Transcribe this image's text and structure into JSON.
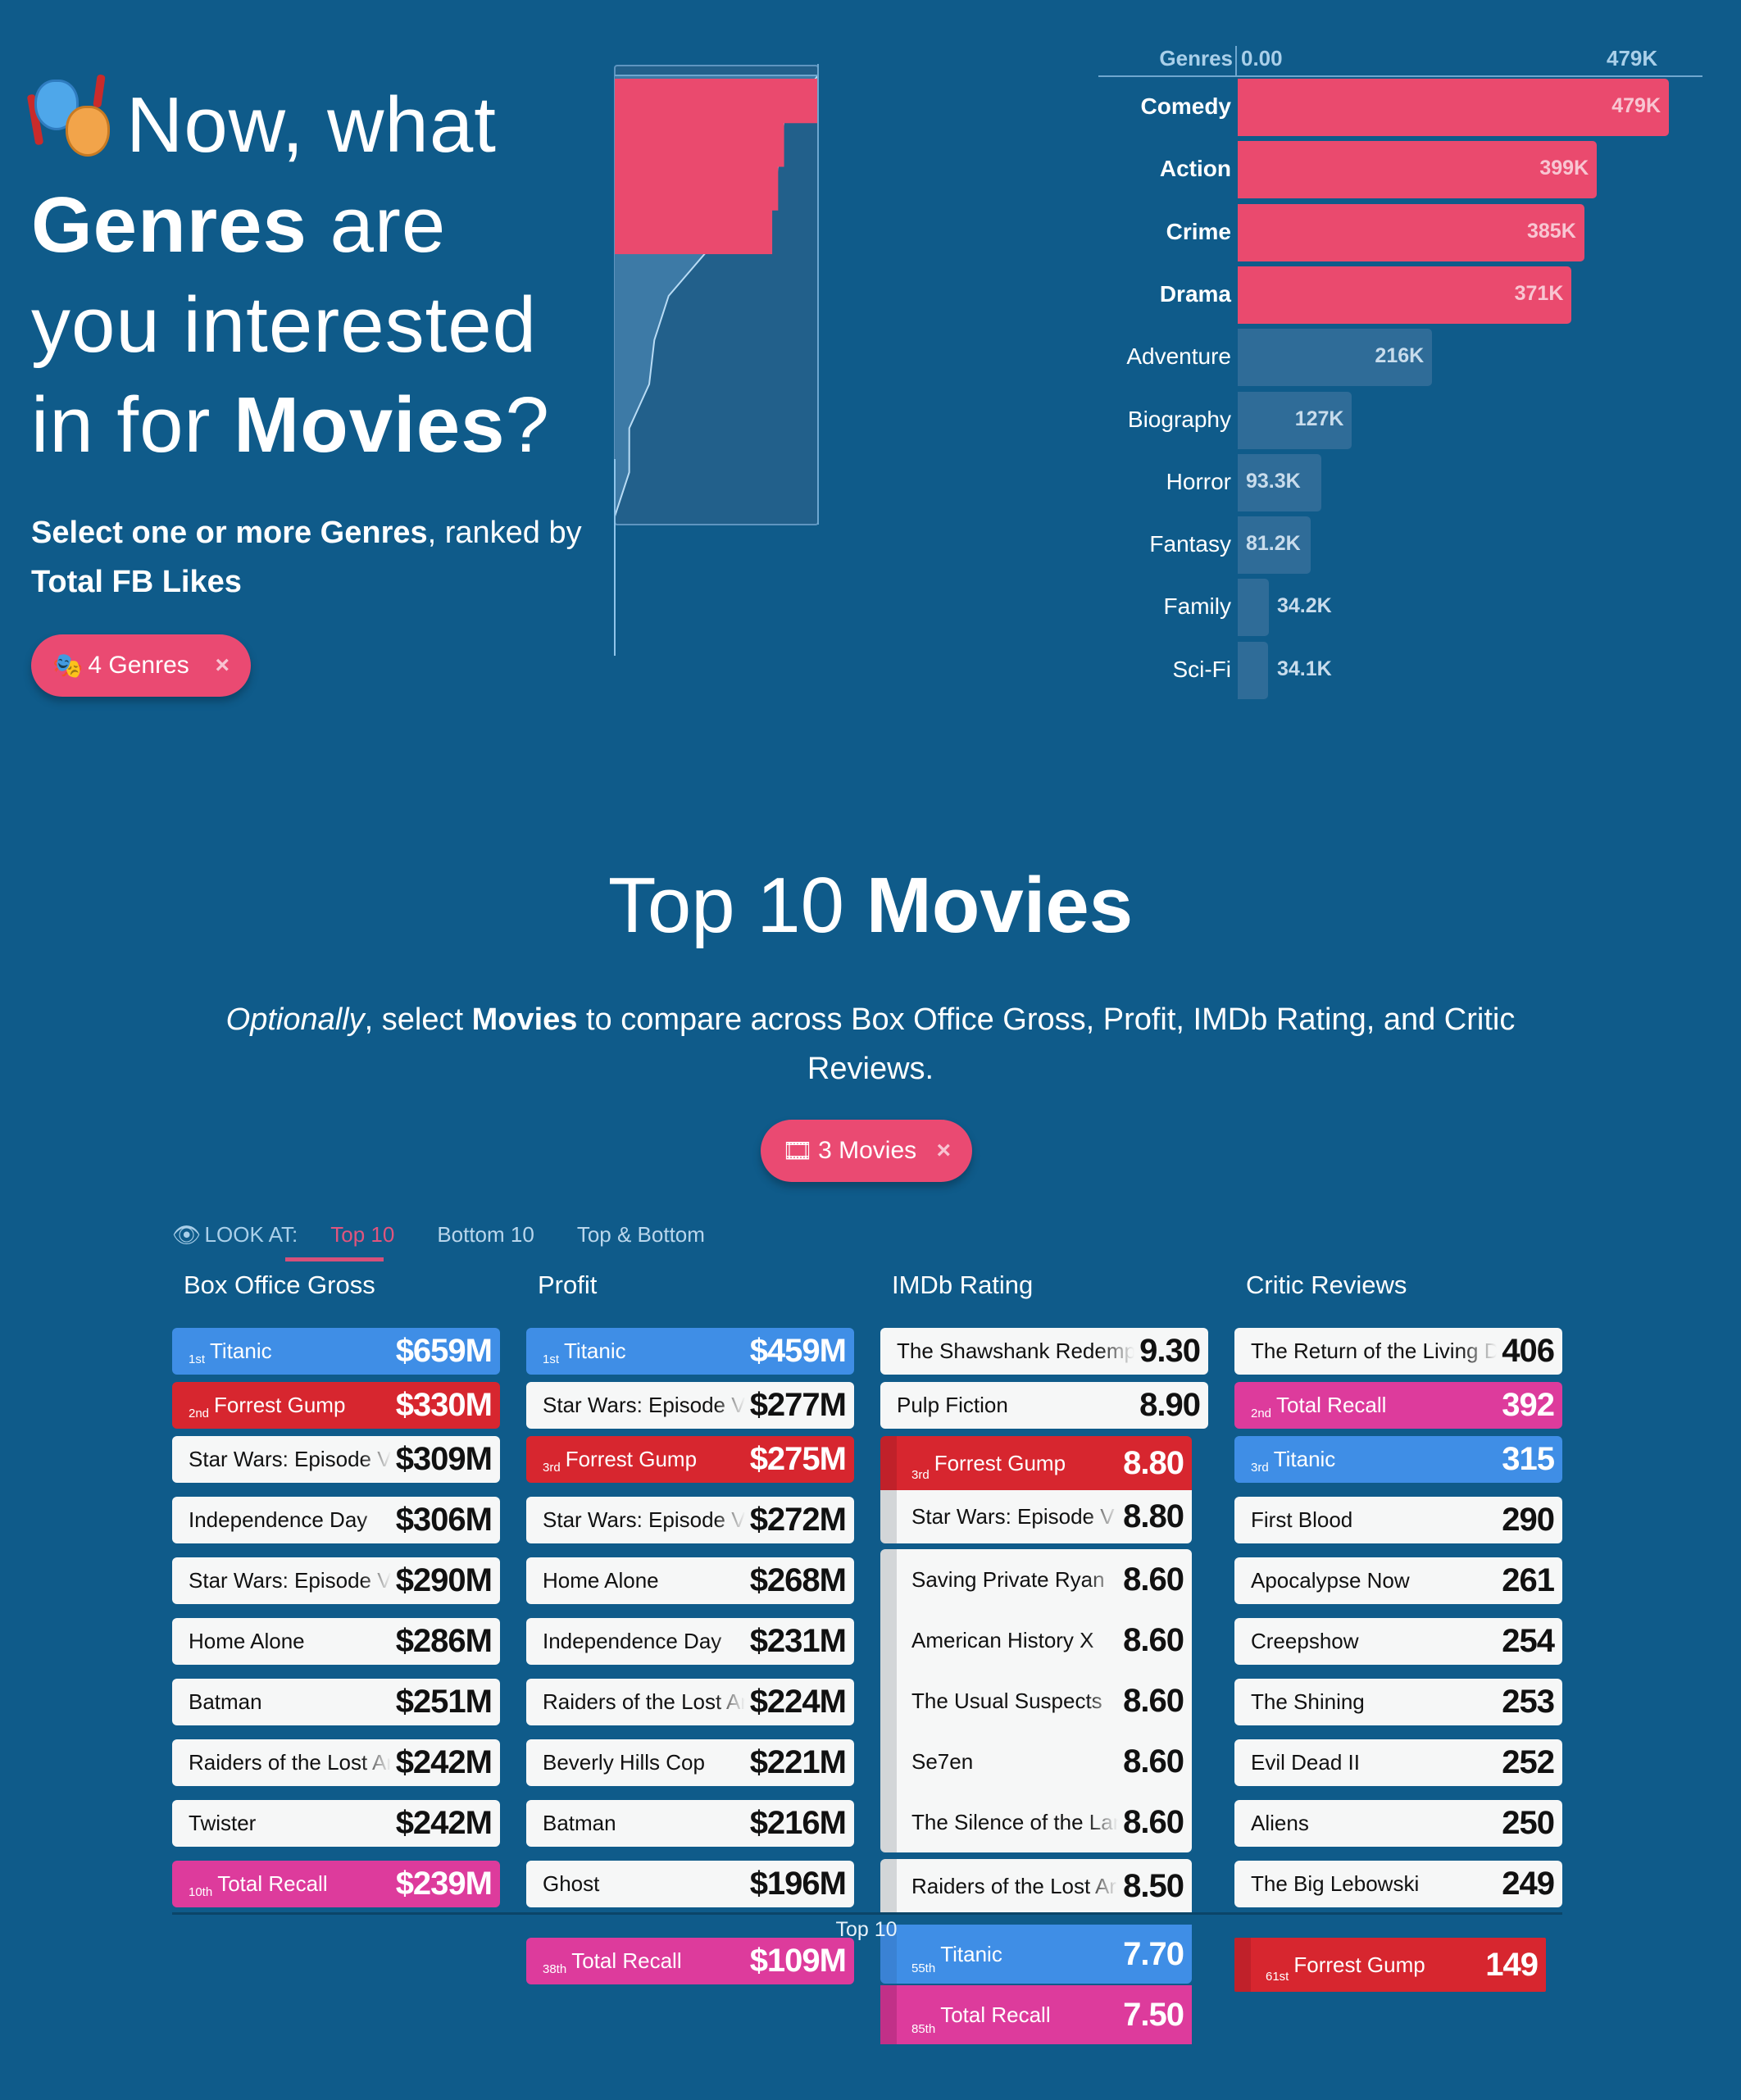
{
  "hero": {
    "icon": "performing-arts-masks-icon",
    "title_line1": "Now, what",
    "title_bold1": "Genres",
    "title_line2_rest": " are",
    "title_line3": "you interested",
    "title_line4_pre": "in for ",
    "title_bold2": "Movies",
    "title_line4_post": "?",
    "subtitle_bold1": "Select one or more Genres",
    "subtitle_mid": ", ranked by ",
    "subtitle_bold2": "Total FB Likes",
    "genre_pill_label": "4 Genres",
    "genre_pill_close": "×"
  },
  "chart_data": {
    "type": "bar",
    "orientation": "horizontal",
    "header_label": "Genres",
    "axis_min_label": "0.00",
    "axis_max_label": "479K",
    "xlim": [
      0,
      479000
    ],
    "categories": [
      "Comedy",
      "Action",
      "Crime",
      "Drama",
      "Adventure",
      "Biography",
      "Horror",
      "Fantasy",
      "Family",
      "Sci-Fi"
    ],
    "values": [
      479000,
      399000,
      385000,
      371000,
      216000,
      127000,
      93300,
      81200,
      34200,
      34100
    ],
    "value_labels": [
      "479K",
      "399K",
      "385K",
      "371K",
      "216K",
      "127K",
      "93.3K",
      "81.2K",
      "34.2K",
      "34.1K"
    ],
    "selected": [
      true,
      true,
      true,
      true,
      false,
      false,
      false,
      false,
      false,
      false
    ],
    "colors": {
      "selected": "#ea4a6e",
      "unselected": "#2f6c98"
    }
  },
  "mini_chart": {
    "values": [
      479000,
      399000,
      385000,
      371000,
      216000,
      127000,
      93300,
      81200,
      34200,
      34100,
      0
    ],
    "selected_count": 4
  },
  "movies": {
    "title_light": "Top 10 ",
    "title_bold": "Movies",
    "sub_italic": "Optionally",
    "sub_pre": ", select ",
    "sub_bold": "Movies",
    "sub_post": " to compare across Box Office Gross, Profit, IMDb Rating, and Critic Reviews.",
    "movie_pill_label": "3 Movies",
    "movie_pill_close": "×",
    "look_at_label": "LOOK AT:",
    "tabs": [
      {
        "label": "Top 10",
        "active": true
      },
      {
        "label": "Bottom 10",
        "active": false
      },
      {
        "label": "Top & Bottom",
        "active": false
      }
    ],
    "footer_label": "Top 10",
    "colors": {
      "Titanic": "#3f8ee6",
      "Forrest Gump": "#d7262f",
      "Total Recall": "#dd3b9c"
    },
    "columns": [
      {
        "header": "Box Office Gross",
        "rows": [
          {
            "rank": "1st",
            "name": "Titanic",
            "value": "$659M",
            "color": "blue"
          },
          {
            "rank": "2nd",
            "name": "Forrest Gump",
            "value": "$330M",
            "color": "red"
          },
          {
            "rank": "",
            "name": "Star Wars: Episode VI",
            "value": "$309M",
            "color": ""
          },
          {
            "rank": "",
            "name": "Independence Day",
            "value": "$306M",
            "color": ""
          },
          {
            "rank": "",
            "name": "Star Wars: Episode V",
            "value": "$290M",
            "color": ""
          },
          {
            "rank": "",
            "name": "Home Alone",
            "value": "$286M",
            "color": ""
          },
          {
            "rank": "",
            "name": "Batman",
            "value": "$251M",
            "color": ""
          },
          {
            "rank": "",
            "name": "Raiders of the Lost Ark",
            "value": "$242M",
            "color": ""
          },
          {
            "rank": "",
            "name": "Twister",
            "value": "$242M",
            "color": ""
          },
          {
            "rank": "10th",
            "name": "Total Recall",
            "value": "$239M",
            "color": "pink"
          }
        ],
        "extra": []
      },
      {
        "header": "Profit",
        "rows": [
          {
            "rank": "1st",
            "name": "Titanic",
            "value": "$459M",
            "color": "blue"
          },
          {
            "rank": "",
            "name": "Star Wars: Episode VI",
            "value": "$277M",
            "color": ""
          },
          {
            "rank": "3rd",
            "name": "Forrest Gump",
            "value": "$275M",
            "color": "red"
          },
          {
            "rank": "",
            "name": "Star Wars: Episode V",
            "value": "$272M",
            "color": ""
          },
          {
            "rank": "",
            "name": "Home Alone",
            "value": "$268M",
            "color": ""
          },
          {
            "rank": "",
            "name": "Independence Day",
            "value": "$231M",
            "color": ""
          },
          {
            "rank": "",
            "name": "Raiders of the Lost Ark",
            "value": "$224M",
            "color": ""
          },
          {
            "rank": "",
            "name": "Beverly Hills Cop",
            "value": "$221M",
            "color": ""
          },
          {
            "rank": "",
            "name": "Batman",
            "value": "$216M",
            "color": ""
          },
          {
            "rank": "",
            "name": "Ghost",
            "value": "$196M",
            "color": ""
          }
        ],
        "extra": [
          {
            "rank": "38th",
            "name": "Total Recall",
            "value": "$109M",
            "color": "pink"
          }
        ]
      },
      {
        "header": "IMDb Rating",
        "rows": [
          {
            "rank": "",
            "name": "The Shawshank Redemption",
            "value": "9.30",
            "color": ""
          },
          {
            "rank": "",
            "name": "Pulp Fiction",
            "value": "8.90",
            "color": ""
          },
          {
            "rank": "3rd",
            "name": "Forrest Gump",
            "value": "8.80",
            "color": "red"
          },
          {
            "rank": "",
            "name": "Star Wars: Episode V",
            "value": "8.80",
            "color": ""
          },
          {
            "rank": "",
            "name": "Saving Private Ryan",
            "value": "8.60",
            "color": ""
          },
          {
            "rank": "",
            "name": "American History X",
            "value": "8.60",
            "color": ""
          },
          {
            "rank": "",
            "name": "The Usual Suspects",
            "value": "8.60",
            "color": ""
          },
          {
            "rank": "",
            "name": "Se7en",
            "value": "8.60",
            "color": ""
          },
          {
            "rank": "",
            "name": "The Silence of the Lambs",
            "value": "8.60",
            "color": ""
          },
          {
            "rank": "",
            "name": "Raiders of the Lost Ark",
            "value": "8.50",
            "color": ""
          }
        ],
        "extra": [
          {
            "rank": "55th",
            "name": "Titanic",
            "value": "7.70",
            "color": "blue"
          },
          {
            "rank": "85th",
            "name": "Total Recall",
            "value": "7.50",
            "color": "pink"
          }
        ]
      },
      {
        "header": "Critic Reviews",
        "rows": [
          {
            "rank": "",
            "name": "The Return of the Living Dead",
            "value": "406",
            "color": ""
          },
          {
            "rank": "2nd",
            "name": "Total Recall",
            "value": "392",
            "color": "pink"
          },
          {
            "rank": "3rd",
            "name": "Titanic",
            "value": "315",
            "color": "blue"
          },
          {
            "rank": "",
            "name": "First Blood",
            "value": "290",
            "color": ""
          },
          {
            "rank": "",
            "name": "Apocalypse Now",
            "value": "261",
            "color": ""
          },
          {
            "rank": "",
            "name": "Creepshow",
            "value": "254",
            "color": ""
          },
          {
            "rank": "",
            "name": "The Shining",
            "value": "253",
            "color": ""
          },
          {
            "rank": "",
            "name": "Evil Dead II",
            "value": "252",
            "color": ""
          },
          {
            "rank": "",
            "name": "Aliens",
            "value": "250",
            "color": ""
          },
          {
            "rank": "",
            "name": "The Big Lebowski",
            "value": "249",
            "color": ""
          }
        ],
        "extra": [
          {
            "rank": "61st",
            "name": "Forrest Gump",
            "value": "149",
            "color": "red"
          }
        ]
      }
    ]
  }
}
